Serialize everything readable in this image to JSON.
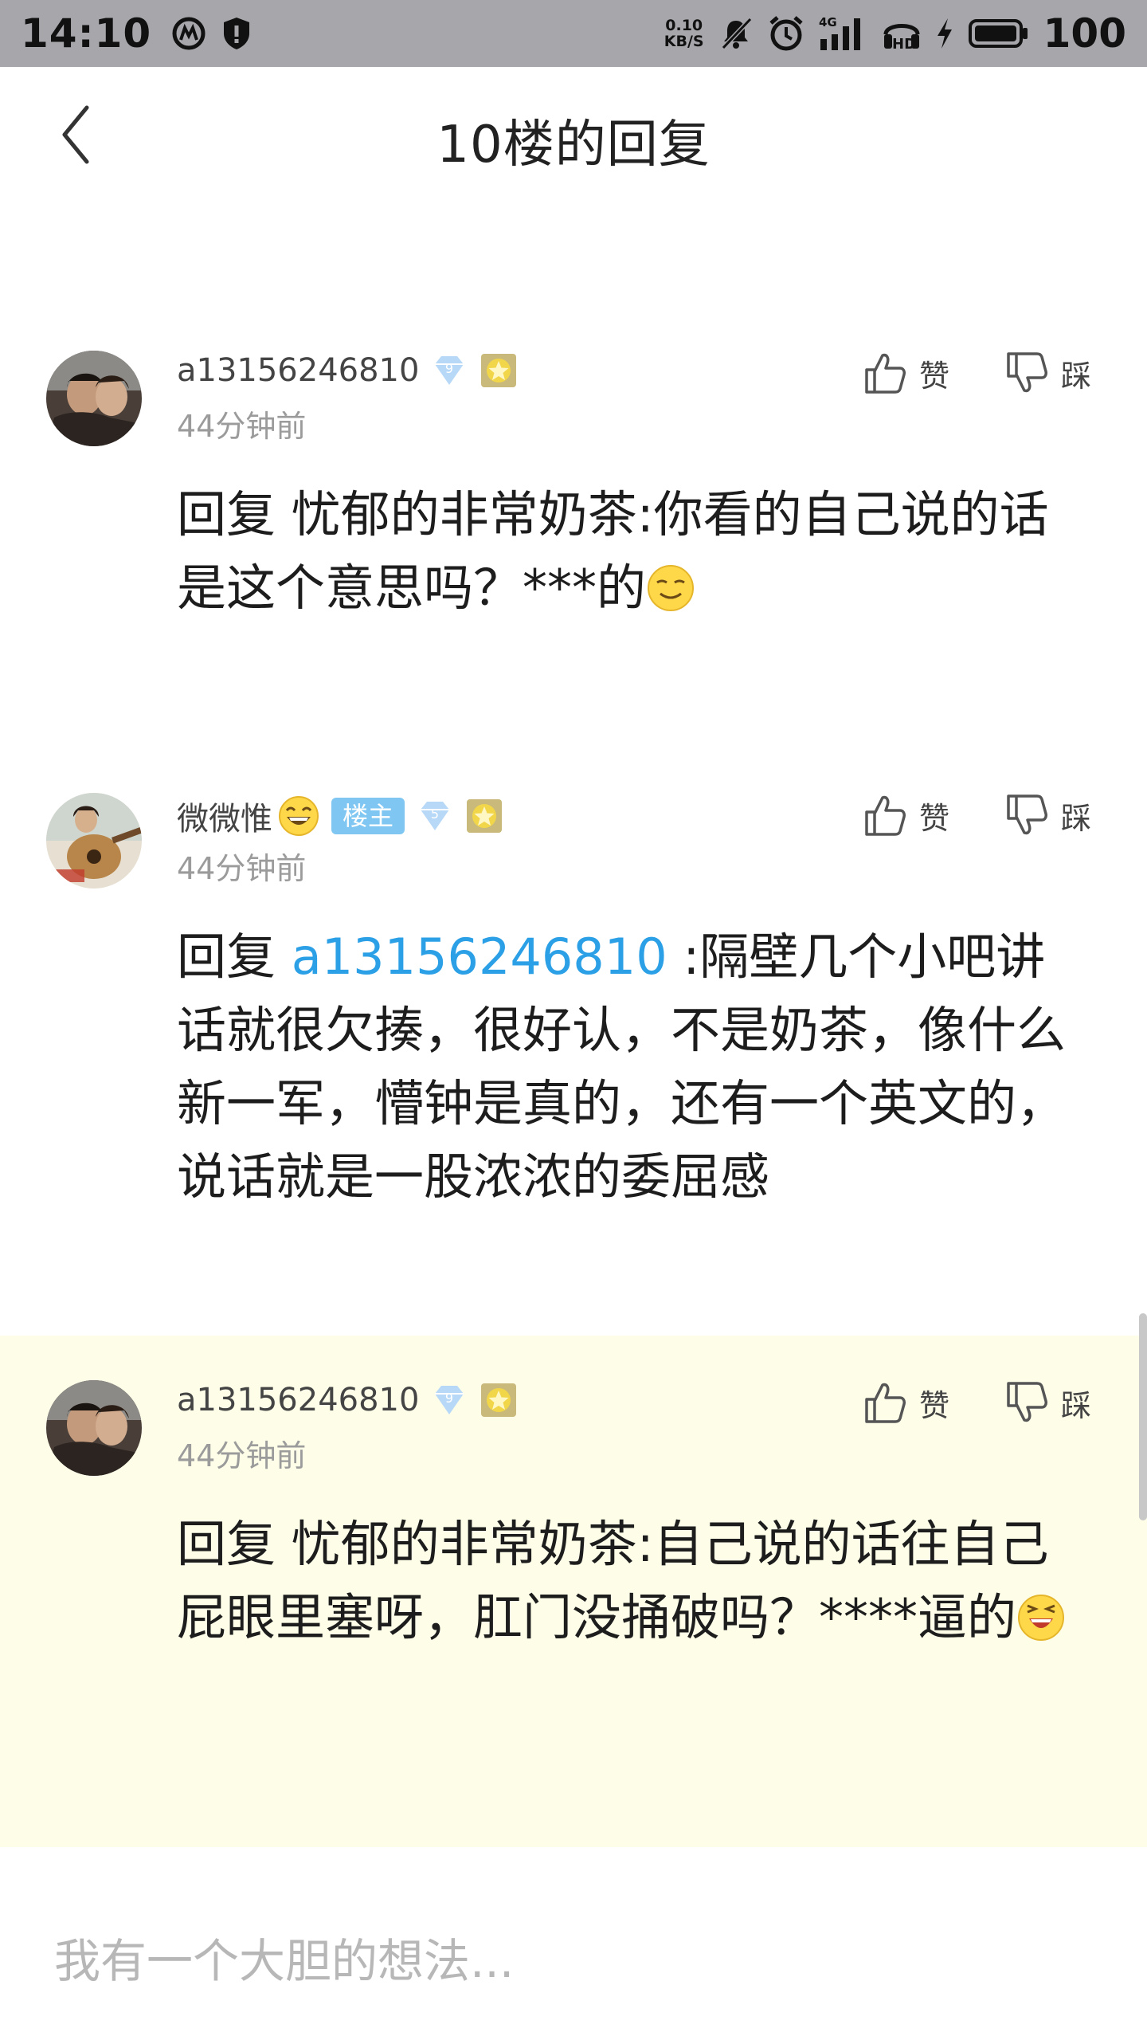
{
  "status_bar": {
    "time": "14:10",
    "net_speed_value": "0.10",
    "net_speed_unit": "KB/S",
    "signal": "4G",
    "hd": "HD",
    "battery": "100"
  },
  "header": {
    "title": "10楼的回复"
  },
  "comments": [
    {
      "username": "a13156246810",
      "level_badge": "9",
      "time": "44分钟前",
      "like_label": "赞",
      "dislike_label": "踩",
      "reply_prefix": "回复",
      "reply_to": "忧郁的非常奶茶",
      "text": ":你看的自己说的话是这个意思吗？***的"
    },
    {
      "username": "微微惟",
      "owner_tag": "楼主",
      "level_badge": "5",
      "time": "44分钟前",
      "like_label": "赞",
      "dislike_label": "踩",
      "reply_prefix": "回复",
      "reply_to": "a13156246810",
      "text": ":隔壁几个小吧讲话就很欠揍，很好认，不是奶茶，像什么新一军，懵钟是真的，还有一个英文的，说话就是一股浓浓的委屈感"
    },
    {
      "username": "a13156246810",
      "level_badge": "9",
      "time": "44分钟前",
      "like_label": "赞",
      "dislike_label": "踩",
      "reply_prefix": "回复",
      "reply_to": "忧郁的非常奶茶",
      "text": ":自己说的话往自己屁眼里塞呀，肛门没捅破吗？****逼的"
    }
  ],
  "input": {
    "placeholder": "我有一个大胆的想法..."
  },
  "colors": {
    "accent": "#2ba0e6",
    "highlight_bg": "#fdfde8",
    "status_bar_bg": "#a7a6ab",
    "owner_tag": "#7fc7f2"
  }
}
